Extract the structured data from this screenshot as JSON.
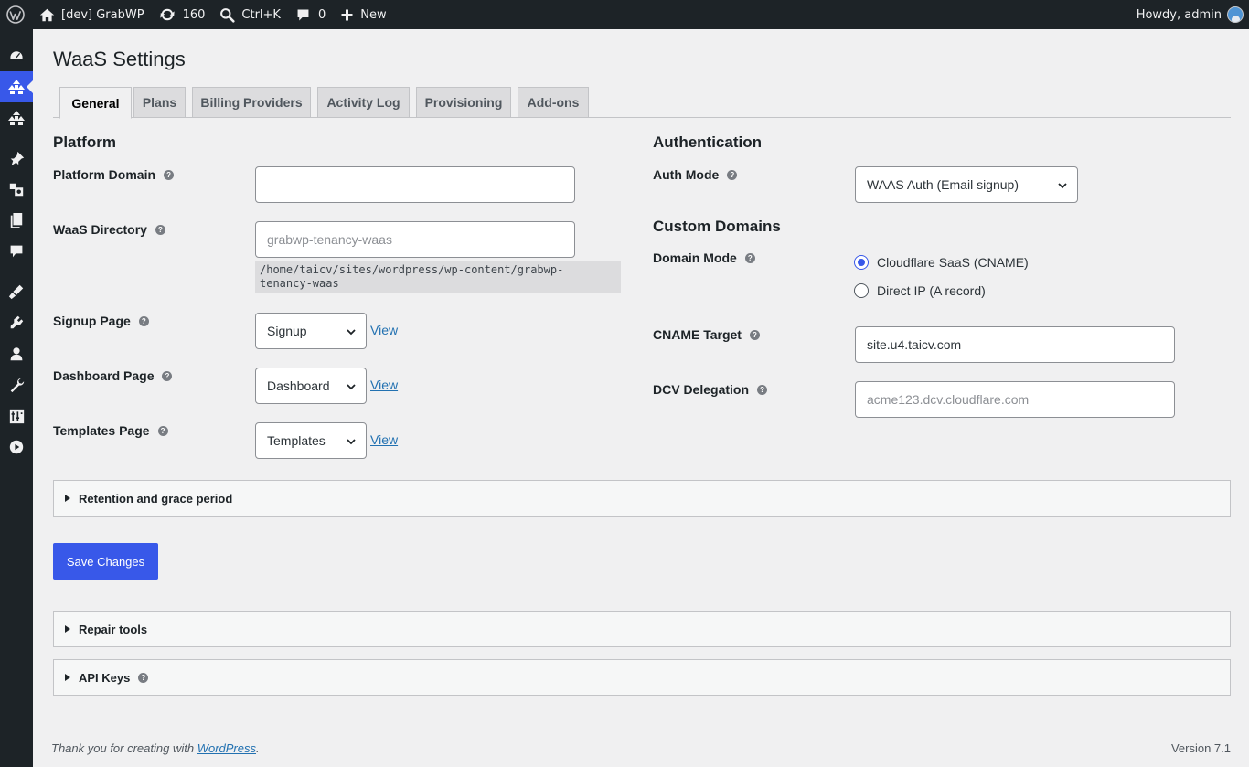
{
  "adminbar": {
    "site_name": "[dev] GrabWP",
    "updates_count": "160",
    "command_shortcut": "Ctrl+K",
    "comments_count": "0",
    "new_label": "New",
    "howdy": "Howdy, admin"
  },
  "sidebar": {
    "icons": [
      "dashboard-icon",
      "waas-icon",
      "network-icon",
      "pin-icon",
      "media-icon",
      "pages-icon",
      "comments-icon",
      "appearance-icon",
      "plugins-icon",
      "users-icon",
      "tools-icon",
      "settings-icon",
      "play-icon"
    ],
    "active_index": 1
  },
  "page": {
    "title": "WaaS Settings",
    "tabs": [
      "General",
      "Plans",
      "Billing Providers",
      "Activity Log",
      "Provisioning",
      "Add-ons"
    ],
    "active_tab": "General"
  },
  "platform": {
    "heading": "Platform",
    "domain_label": "Platform Domain",
    "domain_value": "",
    "directory_label": "WaaS Directory",
    "directory_placeholder": "grabwp-tenancy-waas",
    "directory_path": "/home/taicv/sites/wordpress/wp-content/grabwp-tenancy-waas",
    "signup_label": "Signup Page",
    "signup_value": "Signup",
    "dashboard_label": "Dashboard Page",
    "dashboard_value": "Dashboard",
    "templates_label": "Templates Page",
    "templates_value": "Templates",
    "view_label": "View"
  },
  "authentication": {
    "heading": "Authentication",
    "mode_label": "Auth Mode",
    "mode_value": "WAAS Auth (Email signup)"
  },
  "custom_domains": {
    "heading": "Custom Domains",
    "mode_label": "Domain Mode",
    "options": [
      "Cloudflare SaaS (CNAME)",
      "Direct IP (A record)"
    ],
    "selected": "Cloudflare SaaS (CNAME)",
    "cname_label": "CNAME Target",
    "cname_value": "site.u4.taicv.com",
    "dcv_label": "DCV Delegation",
    "dcv_placeholder": "acme123.dcv.cloudflare.com"
  },
  "sections": {
    "retention": "Retention and grace period",
    "repair": "Repair tools",
    "api_keys": "API Keys"
  },
  "actions": {
    "save": "Save Changes"
  },
  "footer": {
    "thanks_prefix": "Thank you for creating with ",
    "wordpress_link": "WordPress",
    "thanks_suffix": ".",
    "version": "Version 7.1"
  },
  "colors": {
    "accent": "#3858e9",
    "admin_bar": "#1d2327",
    "background": "#f0f0f1",
    "link": "#2271b1"
  }
}
